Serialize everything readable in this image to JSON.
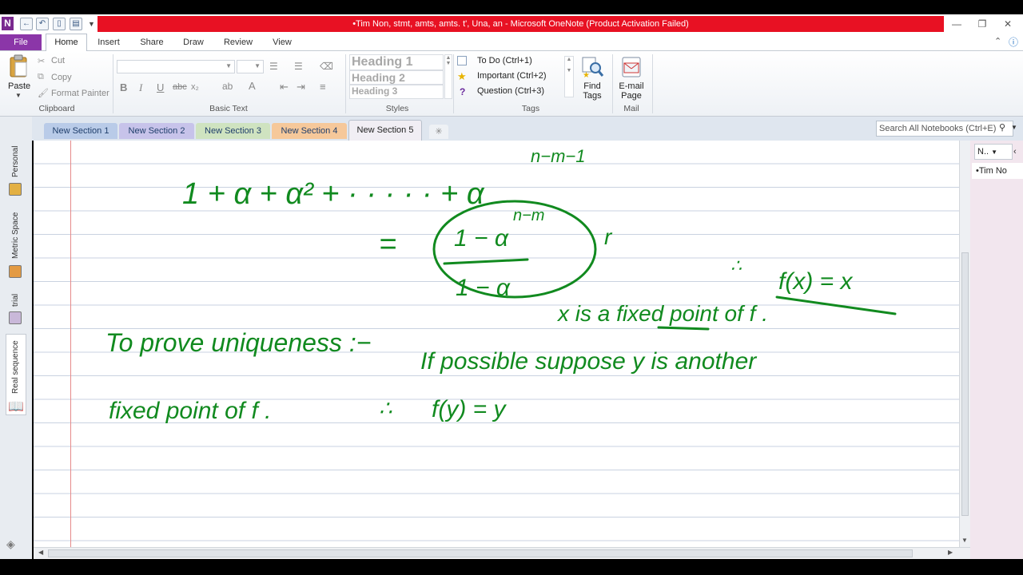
{
  "window": {
    "title": "•Tim Non, stmt, amts, amts. t', Una, an  -  Microsoft OneNote (Product Activation Failed)",
    "logo_letter": "N"
  },
  "menu": {
    "file": "File",
    "tabs": [
      "Home",
      "Insert",
      "Share",
      "Draw",
      "Review",
      "View"
    ]
  },
  "ribbon": {
    "clipboard": {
      "paste": "Paste",
      "cut": "Cut",
      "copy": "Copy",
      "format_painter": "Format Painter",
      "group": "Clipboard"
    },
    "basic_text": {
      "group": "Basic Text"
    },
    "styles": {
      "h1": "Heading 1",
      "h2": "Heading 2",
      "h3": "Heading 3",
      "group": "Styles"
    },
    "tags": {
      "todo": "To Do (Ctrl+1)",
      "important": "Important (Ctrl+2)",
      "question": "Question (Ctrl+3)",
      "find_tags_1": "Find",
      "find_tags_2": "Tags",
      "group": "Tags"
    },
    "mail": {
      "email_1": "E-mail",
      "email_2": "Page",
      "group": "Mail"
    }
  },
  "sections": [
    "New Section 1",
    "New Section 2",
    "New Section 3",
    "New Section 4",
    "New Section 5"
  ],
  "section_colors": [
    "#b9cbe8",
    "#c7c3ea",
    "#cfe3c0",
    "#f6c89a",
    "#f1eef4"
  ],
  "search_placeholder": "Search All Notebooks (Ctrl+E)",
  "notebooks": [
    "Personal",
    "Metric Space",
    "trial",
    "Real sequence"
  ],
  "notebook_colors": [
    "#e3b043",
    "#e39a43",
    "#c9b8d9",
    "#8a8a8a"
  ],
  "right_pane": {
    "header": "N..",
    "page": "•Tim No"
  },
  "ink_text": {
    "series": "1 + α + α² + · · · · · + α",
    "series_exp": "n−m−1",
    "eq": "=",
    "frac_num": "1 − α",
    "frac_num_exp": "n−m",
    "frac_den": "1 − α",
    "trailing": "r",
    "therefore": "∴",
    "fx": "f(x) = x",
    "fixed": "x is a fixed point of f .",
    "uniq": "To prove uniqueness :−",
    "suppose": "If possible suppose y is another",
    "fixed2": "fixed point of f .",
    "fy": "f(y) = y"
  }
}
